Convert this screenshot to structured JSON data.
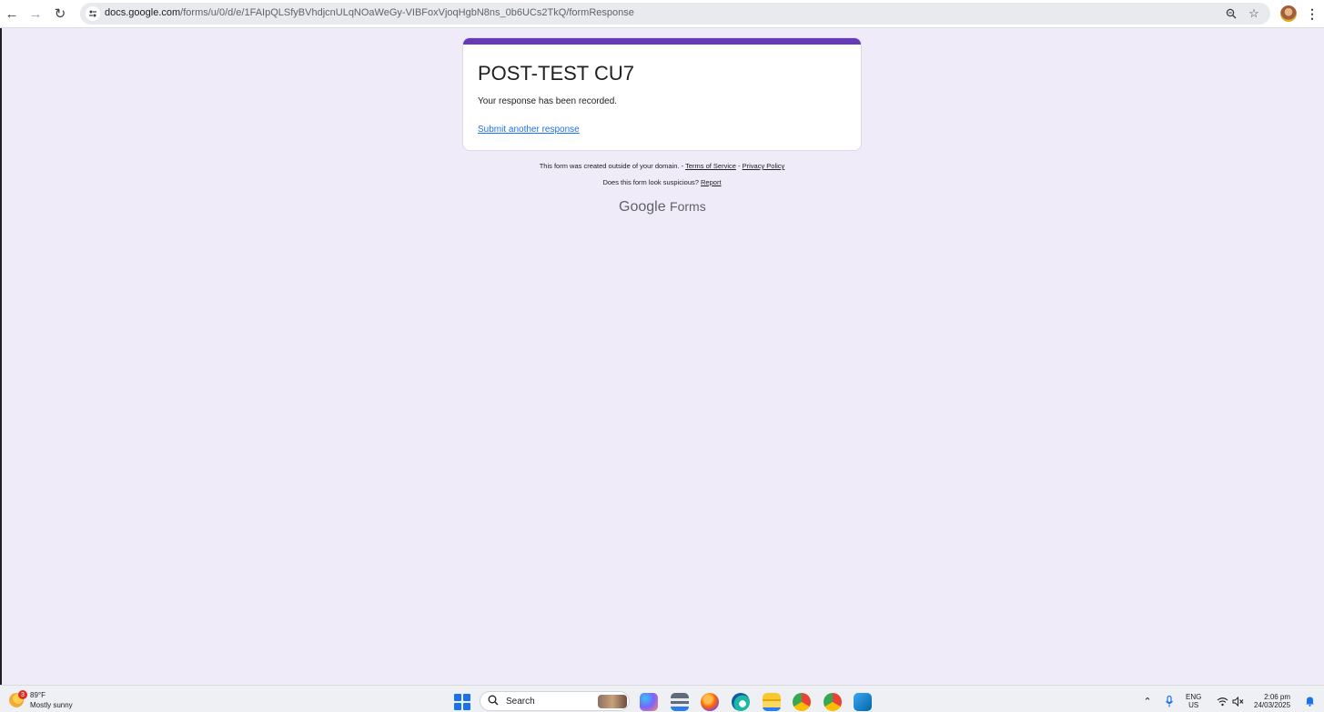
{
  "browser": {
    "url_host": "docs.google.com",
    "url_path": "/forms/u/0/d/e/1FAIpQLSfyBVhdjcnULqNOaWeGy-VIBFoxVjoqHgbN8ns_0b6UCs2TkQ/formResponse"
  },
  "form": {
    "title": "POST-TEST CU7",
    "confirmation": "Your response has been recorded.",
    "submit_another": "Submit another response",
    "accent_color": "#673ab7"
  },
  "footer": {
    "notice": "This form was created outside of your domain. -",
    "terms": "Terms of Service",
    "separator": "-",
    "privacy": "Privacy Policy",
    "suspicious": "Does this form look suspicious?",
    "report": "Report",
    "logo_google": "Google",
    "logo_forms": "Forms"
  },
  "taskbar": {
    "weather_badge": "3",
    "weather_temp": "89°F",
    "weather_desc": "Mostly sunny",
    "search_placeholder": "Search",
    "lang_top": "ENG",
    "lang_bottom": "US",
    "time": "2:06 pm",
    "date": "24/03/2025"
  }
}
